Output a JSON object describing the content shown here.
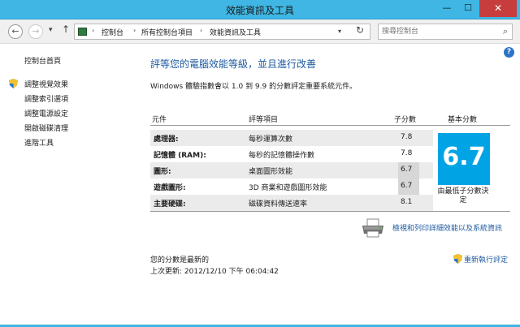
{
  "window": {
    "title": "效能資訊及工具",
    "min_glyph": "—",
    "max_glyph": "☐",
    "close_glyph": "✕"
  },
  "nav": {
    "back_glyph": "←",
    "forward_glyph": "→",
    "dropdown_glyph": "▾",
    "up_glyph": "↑",
    "breadcrumbs": [
      "控制台",
      "所有控制台項目",
      "效能資訊及工具"
    ],
    "separator": "›",
    "address_dropdown_glyph": "▾",
    "refresh_glyph": "↻",
    "search_placeholder": "搜尋控制台",
    "search_glyph": "⌕"
  },
  "sidebar": {
    "items": [
      {
        "label": "控制台首頁",
        "shield": false
      },
      {
        "label": "調整視覺效果",
        "shield": true
      },
      {
        "label": "調整索引選項",
        "shield": false
      },
      {
        "label": "調整電源設定",
        "shield": false
      },
      {
        "label": "開啟磁碟清理",
        "shield": false
      },
      {
        "label": "進階工具",
        "shield": false
      }
    ]
  },
  "help_glyph": "?",
  "main": {
    "heading": "評等您的電腦效能等級，並且進行改善",
    "intro": "Windows 體驗指數會以 1.0 到 9.9 的分數評定重要系統元件。",
    "table": {
      "headers": [
        "元件",
        "評等項目",
        "子分數",
        "基本分數"
      ],
      "rows": [
        {
          "component": "處理器:",
          "item": "每秒運算次數",
          "score": "7.8"
        },
        {
          "component": "記憶體 (RAM):",
          "item": "每秒的記憶體操作數",
          "score": "7.8"
        },
        {
          "component": "圖形:",
          "item": "桌面圖形效能",
          "score": "6.7"
        },
        {
          "component": "遊戲圖形:",
          "item": "3D 商業和遊戲圖形效能",
          "score": "6.7"
        },
        {
          "component": "主要硬碟:",
          "item": "磁碟資料傳送速率",
          "score": "8.1"
        }
      ],
      "base_score": "6.7",
      "base_note": "由最低子分數決定"
    },
    "print_link": "檢視和列印詳細效能以及系統資訊",
    "status_line1": "您的分數是最新的",
    "status_line2": "上次更新: 2012/12/10 下午 06:04:42",
    "rerun_link": "重新執行評定"
  },
  "colors": {
    "titlebar": "#3fb6e3",
    "score_tile": "#00a4e4",
    "link": "#1e5aa0",
    "heading": "#1e5aa0"
  }
}
